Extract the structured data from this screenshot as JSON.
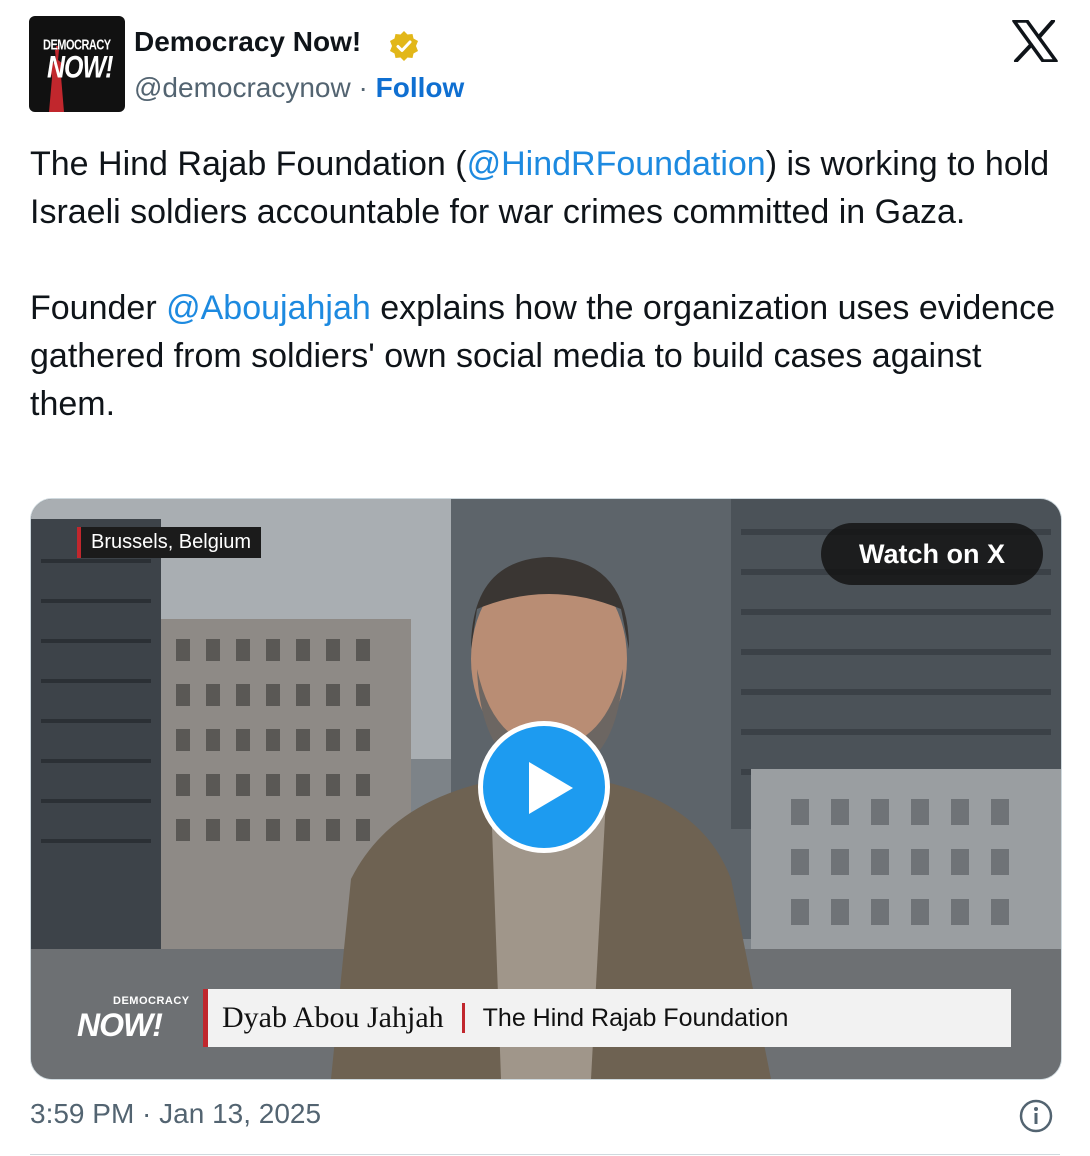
{
  "account": {
    "display_name": "Democracy Now!",
    "handle": "@democracynow",
    "separator": "·",
    "follow_label": "Follow",
    "avatar_text_top": "DEMOCRACY",
    "avatar_text_big": "NOW!"
  },
  "tweet": {
    "p1_before": "The Hind Rajab Foundation (",
    "p1_mention": "@HindRFoundation",
    "p1_after": ") is working to hold Israeli soldiers accountable for war crimes committed in Gaza.",
    "p2_before": "Founder ",
    "p2_mention": "@Aboujahjah",
    "p2_after": " explains how the organization uses evidence gathered from soldiers' own social media to build cases against them."
  },
  "media": {
    "location": "Brussels, Belgium",
    "watch_label": "Watch on X",
    "lower_third_name": "Dyab Abou Jahjah",
    "lower_third_org": "The Hind Rajab Foundation",
    "brand_small": "DEMOCRACY",
    "brand_big": "NOW!"
  },
  "timestamp": "3:59 PM · Jan 13, 2025",
  "colors": {
    "mention": "#1d8ae0",
    "follow": "#0f6fd1",
    "play_button": "#1d9bf0",
    "brand_red": "#c1272d"
  },
  "icons": [
    "verified-badge-icon",
    "x-logo-icon",
    "play-icon",
    "info-icon"
  ]
}
